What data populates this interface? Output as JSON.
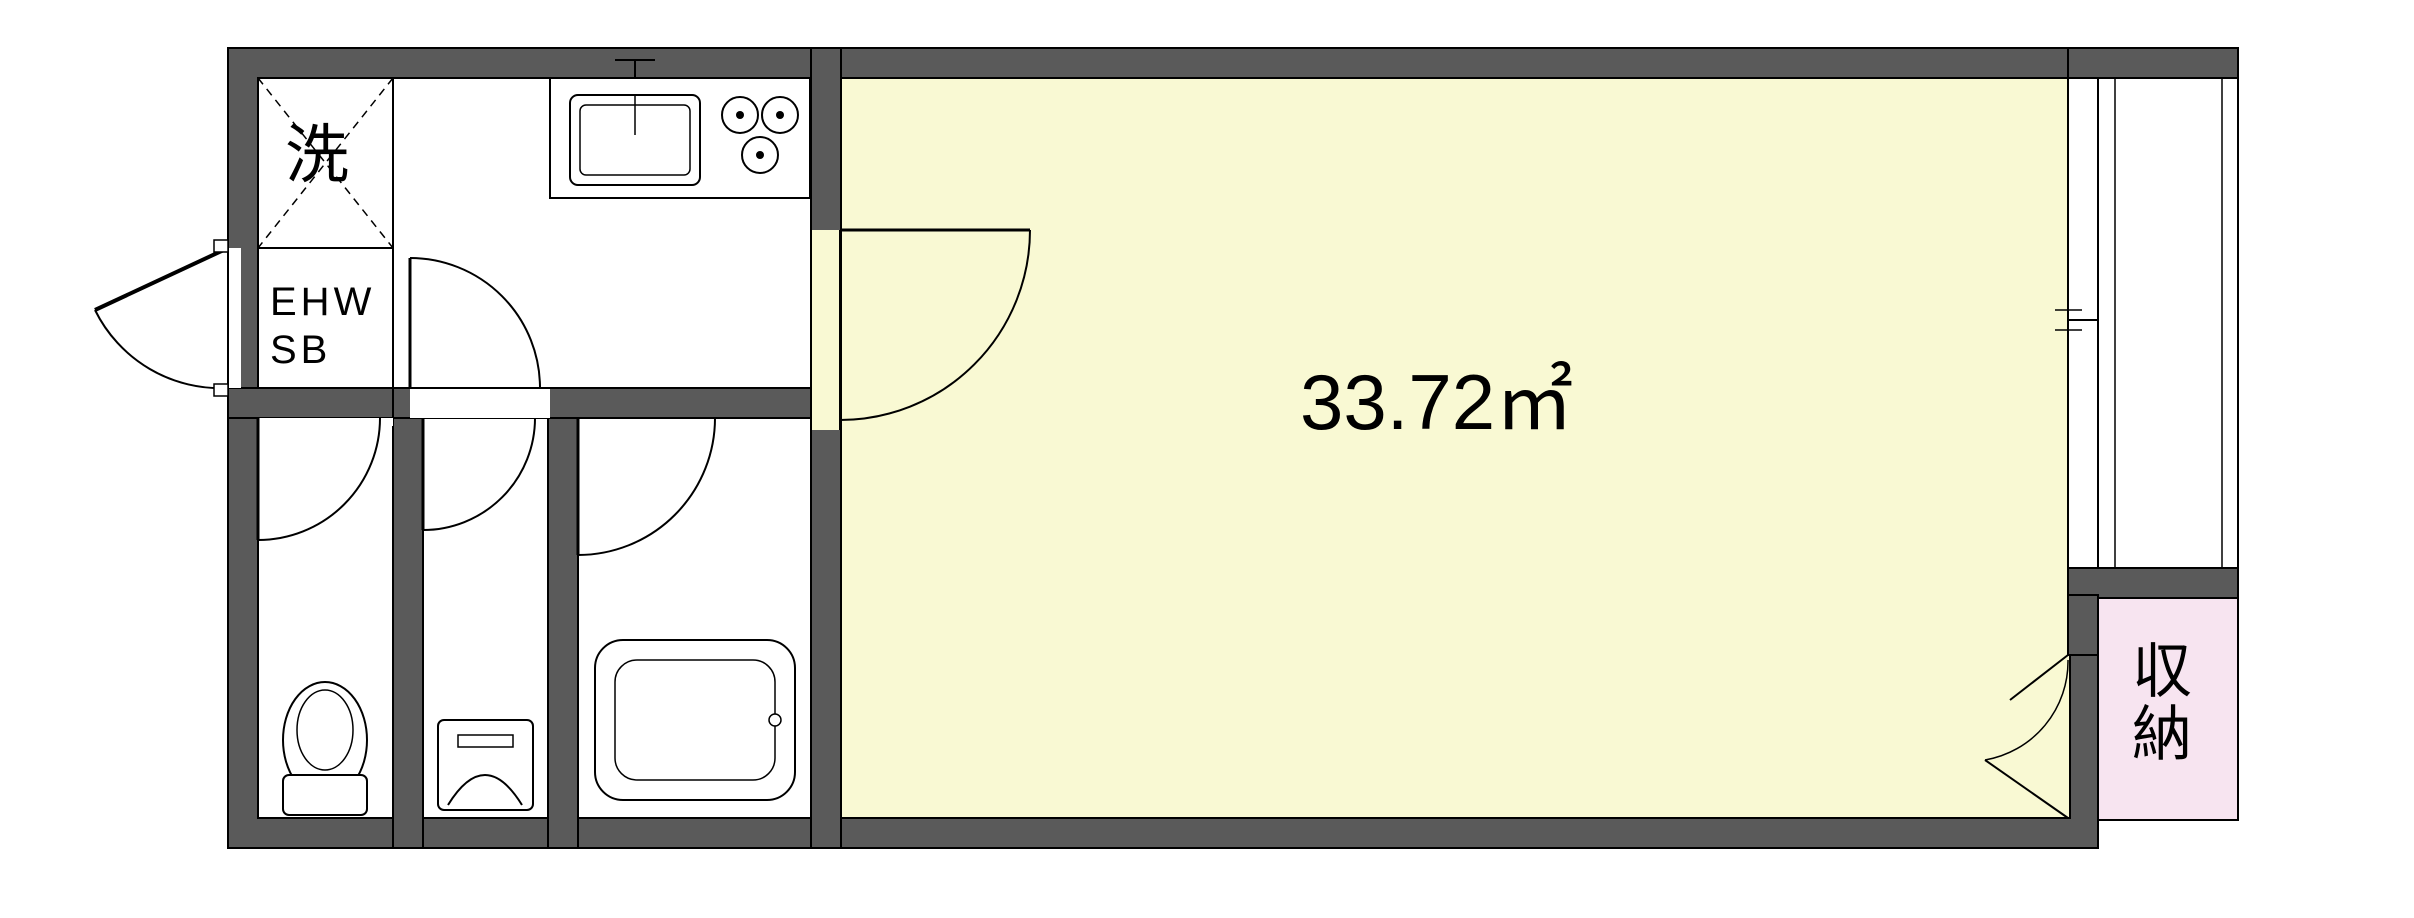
{
  "labels": {
    "washing": "洗",
    "ehw": "EHW",
    "sb": "SB",
    "area": "33.72㎡",
    "storage": "収\n納"
  },
  "colors": {
    "wall_fill": "#5a5a5a",
    "wall_stroke": "#000000",
    "room_fill": "#f9f9d3",
    "storage_fill": "#f7e4f0",
    "white": "#ffffff",
    "line": "#000000"
  }
}
